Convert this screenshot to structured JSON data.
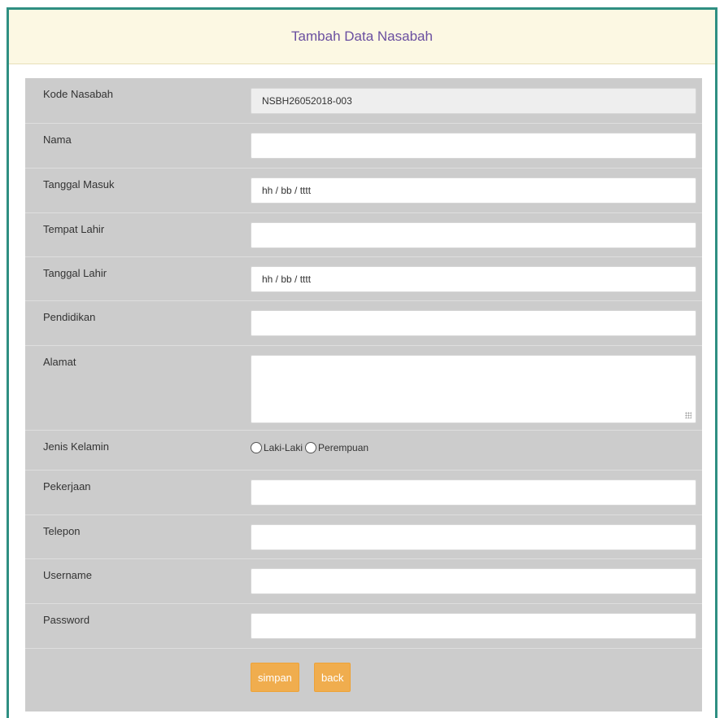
{
  "header": {
    "title": "Tambah Data Nasabah"
  },
  "form": {
    "kode_nasabah": {
      "label": "Kode Nasabah",
      "value": "NSBH26052018-003"
    },
    "nama": {
      "label": "Nama",
      "value": ""
    },
    "tanggal_masuk": {
      "label": "Tanggal Masuk",
      "placeholder": "hh / bb / tttt"
    },
    "tempat_lahir": {
      "label": "Tempat Lahir",
      "value": ""
    },
    "tanggal_lahir": {
      "label": "Tanggal Lahir",
      "placeholder": "hh / bb / tttt"
    },
    "pendidikan": {
      "label": "Pendidikan",
      "value": ""
    },
    "alamat": {
      "label": "Alamat",
      "value": ""
    },
    "jenis_kelamin": {
      "label": "Jenis Kelamin",
      "options": [
        "Laki-Laki",
        "Perempuan"
      ],
      "selected": null
    },
    "pekerjaan": {
      "label": "Pekerjaan",
      "value": ""
    },
    "telepon": {
      "label": "Telepon",
      "value": ""
    },
    "username": {
      "label": "Username",
      "value": ""
    },
    "password": {
      "label": "Password",
      "value": ""
    }
  },
  "buttons": {
    "save_label": "simpan",
    "back_label": "back"
  },
  "colors": {
    "panel_border": "#2f8f82",
    "heading_bg": "#fcf8e3",
    "heading_text": "#6a4fa0",
    "form_bg": "#cccccc",
    "button_bg": "#f0ad4e"
  }
}
